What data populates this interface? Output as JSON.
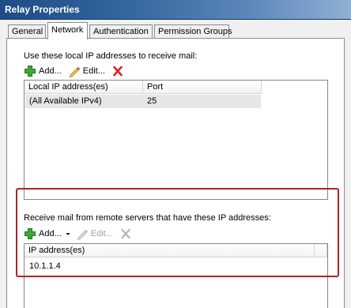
{
  "window": {
    "title": "Relay Properties"
  },
  "tabs": [
    {
      "label": "General"
    },
    {
      "label": "Network"
    },
    {
      "label": "Authentication"
    },
    {
      "label": "Permission Groups"
    }
  ],
  "active_tab": "Network",
  "local_section": {
    "caption": "Use these local IP addresses to receive mail:",
    "toolbar": {
      "add_label": "Add...",
      "edit_label": "Edit..."
    },
    "columns": [
      "Local IP address(es)",
      "Port"
    ],
    "rows": [
      {
        "address": "(All Available IPv4)",
        "port": "25",
        "selected": true
      }
    ]
  },
  "remote_section": {
    "caption": "Receive mail from remote servers that have these IP addresses:",
    "toolbar": {
      "add_label": "Add...",
      "edit_label": "Edit..."
    },
    "columns": [
      "IP address(es)"
    ],
    "rows": [
      {
        "address": "10.1.1.4"
      }
    ]
  },
  "icons": {
    "add": "green-plus-icon",
    "edit": "pencil-icon",
    "remove": "red-x-icon",
    "dropdown": "dropdown-arrow-icon"
  },
  "colors": {
    "title_bar": "#33659e",
    "highlight_frame": "#b22222",
    "add_icon": "#3fa83a",
    "remove_icon": "#e02020"
  }
}
